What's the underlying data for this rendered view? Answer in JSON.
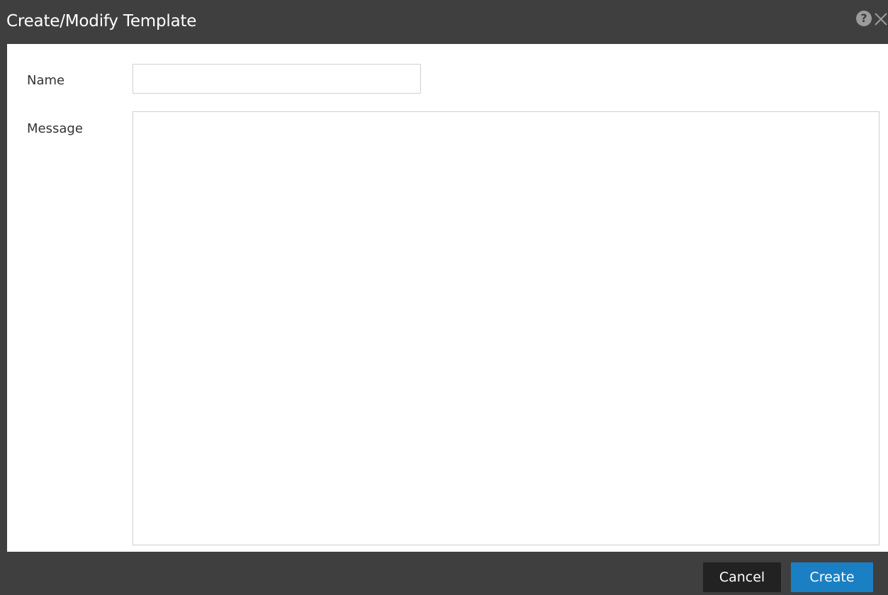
{
  "dialog": {
    "title": "Create/Modify Template",
    "icons": {
      "help": "help-icon",
      "close": "close-icon"
    }
  },
  "form": {
    "name": {
      "label": "Name",
      "value": "",
      "placeholder": ""
    },
    "message": {
      "label": "Message",
      "value": "",
      "placeholder": ""
    }
  },
  "footer": {
    "cancel_label": "Cancel",
    "create_label": "Create"
  },
  "colors": {
    "chrome": "#3f3f3f",
    "primary": "#1b7fc4",
    "secondary": "#222222",
    "panel": "#ffffff"
  }
}
